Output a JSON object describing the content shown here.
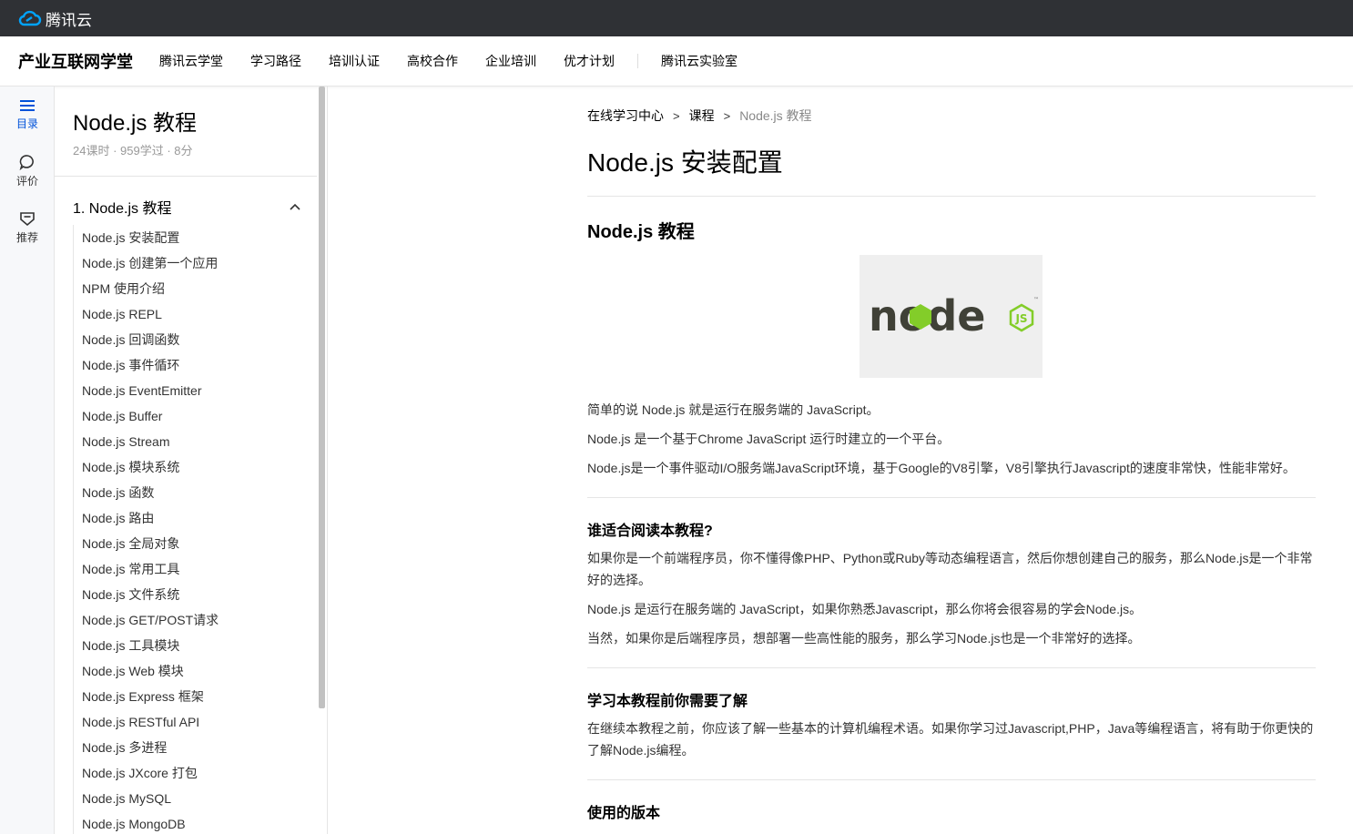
{
  "topbar": {
    "brand": "腾讯云"
  },
  "navbar": {
    "title": "产业互联网学堂",
    "items": [
      "腾讯云学堂",
      "学习路径",
      "培训认证",
      "高校合作",
      "企业培训",
      "优才计划"
    ],
    "extra": "腾讯云实验室"
  },
  "rail": {
    "catalog": "目录",
    "review": "评价",
    "recommend": "推荐",
    "accent": "#0052d9"
  },
  "course": {
    "title": "Node.js 教程",
    "meta": "24课时 · 959学过 · 8分",
    "chapter": "1. Node.js 教程",
    "lessons": [
      "Node.js 安装配置",
      "Node.js 创建第一个应用",
      "NPM 使用介绍",
      "Node.js REPL",
      "Node.js 回调函数",
      "Node.js 事件循环",
      "Node.js EventEmitter",
      "Node.js Buffer",
      "Node.js Stream",
      "Node.js 模块系统",
      "Node.js 函数",
      "Node.js 路由",
      "Node.js 全局对象",
      "Node.js 常用工具",
      "Node.js 文件系统",
      "Node.js GET/POST请求",
      "Node.js 工具模块",
      "Node.js Web 模块",
      "Node.js Express 框架",
      "Node.js RESTful API",
      "Node.js 多进程",
      "Node.js JXcore 打包",
      "Node.js MySQL",
      "Node.js MongoDB"
    ]
  },
  "article": {
    "breadcrumb": [
      "在线学习中心",
      "课程",
      "Node.js 教程"
    ],
    "title": "Node.js 安装配置",
    "h_intro": "Node.js 教程",
    "intro_p1": "简单的说 Node.js 就是运行在服务端的 JavaScript。",
    "intro_p2": "Node.js 是一个基于Chrome JavaScript 运行时建立的一个平台。",
    "intro_p3": "Node.js是一个事件驱动I/O服务端JavaScript环境，基于Google的V8引擎，V8引擎执行Javascript的速度非常快，性能非常好。",
    "h_who": "谁适合阅读本教程?",
    "who_p1": "如果你是一个前端程序员，你不懂得像PHP、Python或Ruby等动态编程语言，然后你想创建自己的服务，那么Node.js是一个非常好的选择。",
    "who_p2": "Node.js 是运行在服务端的 JavaScript，如果你熟悉Javascript，那么你将会很容易的学会Node.js。",
    "who_p3": "当然，如果你是后端程序员，想部署一些高性能的服务，那么学习Node.js也是一个非常好的选择。",
    "h_before": "学习本教程前你需要了解",
    "before_p1": "在继续本教程之前，你应该了解一些基本的计算机编程术语。如果你学习过Javascript,PHP，Java等编程语言，将有助于你更快的了解Node.js编程。",
    "h_version": "使用的版本",
    "logo_text": "node",
    "logo_badge": "JS",
    "logo_tm": "™"
  }
}
